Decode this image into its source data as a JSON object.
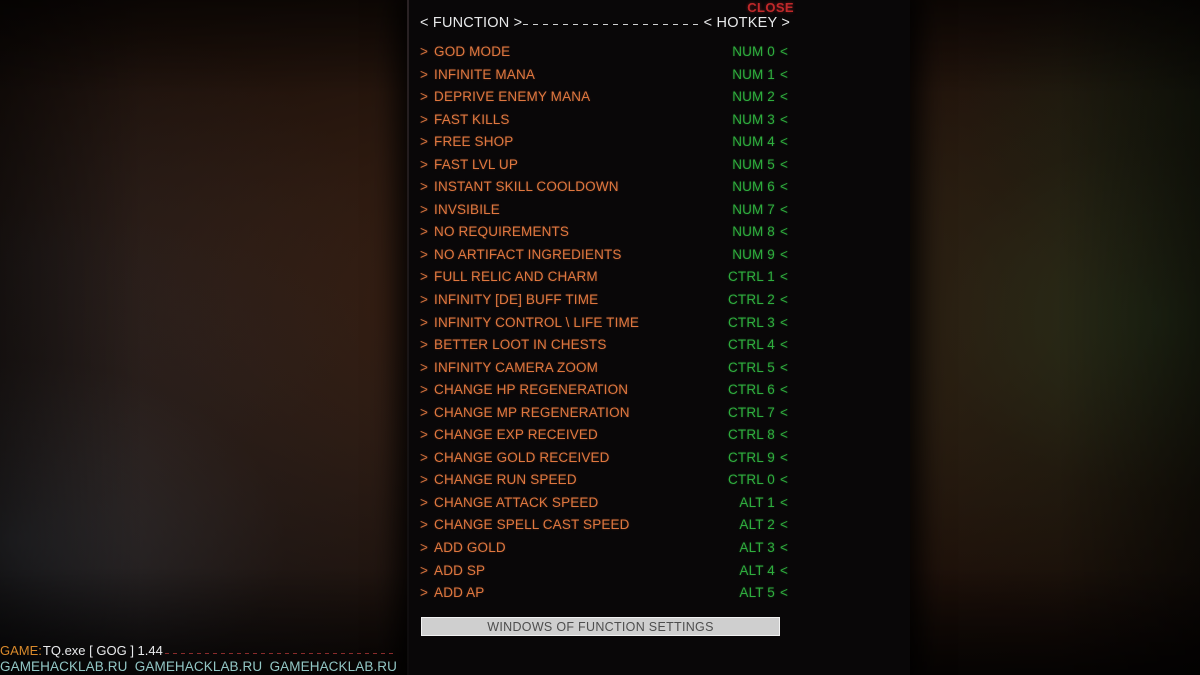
{
  "window": {
    "close_label": "CLOSE"
  },
  "header": {
    "function_label": "< FUNCTION >",
    "hotkey_label": "< HOTKEY >"
  },
  "cheats": [
    {
      "caret": ">",
      "name": "GOD MODE",
      "hotkey": "NUM 0",
      "caret_right": "<"
    },
    {
      "caret": ">",
      "name": "INFINITE MANA",
      "hotkey": "NUM 1",
      "caret_right": "<"
    },
    {
      "caret": ">",
      "name": "DEPRIVE ENEMY MANA",
      "hotkey": "NUM 2",
      "caret_right": "<"
    },
    {
      "caret": ">",
      "name": "FAST KILLS",
      "hotkey": "NUM 3",
      "caret_right": "<"
    },
    {
      "caret": ">",
      "name": "FREE SHOP",
      "hotkey": "NUM 4",
      "caret_right": "<"
    },
    {
      "caret": ">",
      "name": "FAST LVL UP",
      "hotkey": "NUM 5",
      "caret_right": "<"
    },
    {
      "caret": ">",
      "name": "INSTANT SKILL COOLDOWN",
      "hotkey": "NUM 6",
      "caret_right": "<"
    },
    {
      "caret": ">",
      "name": "INVSIBILE",
      "hotkey": "NUM 7",
      "caret_right": "<"
    },
    {
      "caret": ">",
      "name": "NO REQUIREMENTS",
      "hotkey": "NUM 8",
      "caret_right": "<"
    },
    {
      "caret": ">",
      "name": "NO ARTIFACT INGREDIENTS",
      "hotkey": "NUM 9",
      "caret_right": "<"
    },
    {
      "caret": ">",
      "name": "FULL RELIC AND CHARM",
      "hotkey": "CTRL 1",
      "caret_right": "<"
    },
    {
      "caret": ">",
      "name": "INFINITY [DE] BUFF TIME",
      "hotkey": "CTRL 2",
      "caret_right": "<"
    },
    {
      "caret": ">",
      "name": "INFINITY CONTROL \\ LIFE TIME",
      "hotkey": "CTRL 3",
      "caret_right": "<"
    },
    {
      "caret": ">",
      "name": "BETTER LOOT IN CHESTS",
      "hotkey": "CTRL 4",
      "caret_right": "<"
    },
    {
      "caret": ">",
      "name": "INFINITY CAMERA ZOOM",
      "hotkey": "CTRL 5",
      "caret_right": "<"
    },
    {
      "caret": ">",
      "name": "CHANGE HP REGENERATION",
      "hotkey": "CTRL 6",
      "caret_right": "<"
    },
    {
      "caret": ">",
      "name": "CHANGE MP REGENERATION",
      "hotkey": "CTRL 7",
      "caret_right": "<"
    },
    {
      "caret": ">",
      "name": "CHANGE EXP RECEIVED",
      "hotkey": "CTRL 8",
      "caret_right": "<"
    },
    {
      "caret": ">",
      "name": "CHANGE GOLD RECEIVED",
      "hotkey": "CTRL 9",
      "caret_right": "<"
    },
    {
      "caret": ">",
      "name": "CHANGE RUN SPEED",
      "hotkey": "CTRL 0",
      "caret_right": "<"
    },
    {
      "caret": ">",
      "name": "CHANGE ATTACK SPEED",
      "hotkey": "ALT 1",
      "caret_right": "<"
    },
    {
      "caret": ">",
      "name": "CHANGE SPELL CAST SPEED",
      "hotkey": "ALT 2",
      "caret_right": "<"
    },
    {
      "caret": ">",
      "name": "ADD GOLD",
      "hotkey": "ALT 3",
      "caret_right": "<"
    },
    {
      "caret": ">",
      "name": "ADD SP",
      "hotkey": "ALT 4",
      "caret_right": "<"
    },
    {
      "caret": ">",
      "name": "ADD AP",
      "hotkey": "ALT 5",
      "caret_right": "<"
    }
  ],
  "settings": {
    "button_label": "WINDOWS OF FUNCTION SETTINGS"
  },
  "footer": {
    "game_label": "GAME:",
    "game_value": "TQ.exe [ GOG ] 1.44",
    "watermarks": [
      "GAMEHACKLAB.RU",
      "GAMEHACKLAB.RU",
      "GAMEHACKLAB.RU"
    ]
  },
  "colors": {
    "function_text": "#e0773f",
    "hotkey_text": "#2fae3e",
    "close_text": "#c0282a",
    "header_text": "#e8e9ea",
    "game_label": "#d98a2b",
    "watermark": "#9fd8d6",
    "panel_bg": "#090708",
    "settings_button_bg": "#cfcfcf"
  }
}
